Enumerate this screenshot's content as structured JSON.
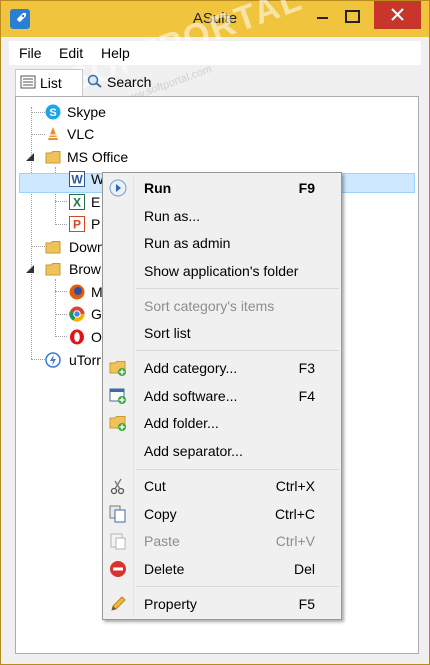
{
  "window": {
    "title": "ASuite"
  },
  "menubar": {
    "items": [
      "File",
      "Edit",
      "Help"
    ]
  },
  "tabs": [
    {
      "label": "List",
      "icon": "list-icon"
    },
    {
      "label": "Search",
      "icon": "search-icon"
    }
  ],
  "watermark": {
    "text": "SOFTPORTAL",
    "url": "www.softportal.com"
  },
  "tree": {
    "items": [
      {
        "label": "Skype",
        "icon": "skype-icon"
      },
      {
        "label": "VLC",
        "icon": "vlc-icon"
      },
      {
        "label": "MS Office",
        "icon": "folder-icon"
      },
      {
        "label": "W",
        "icon": "word-icon"
      },
      {
        "label": "E",
        "icon": "excel-icon"
      },
      {
        "label": "P",
        "icon": "powerpoint-icon"
      },
      {
        "label": "Down",
        "icon": "folder-icon"
      },
      {
        "label": "Brow",
        "icon": "folder-icon"
      },
      {
        "label": "M",
        "icon": "firefox-icon"
      },
      {
        "label": "G",
        "icon": "chrome-icon"
      },
      {
        "label": "O",
        "icon": "opera-icon"
      },
      {
        "label": "uTorr",
        "icon": "utorrent-icon"
      }
    ]
  },
  "context_menu": {
    "items": [
      {
        "label": "Run",
        "shortcut": "F9",
        "icon": "run-icon"
      },
      {
        "label": "Run as...",
        "shortcut": "",
        "icon": ""
      },
      {
        "label": "Run as admin",
        "shortcut": "",
        "icon": ""
      },
      {
        "label": "Show application's folder",
        "shortcut": "",
        "icon": ""
      },
      {
        "label": "Sort category's items",
        "shortcut": "",
        "icon": "",
        "disabled": true
      },
      {
        "label": "Sort list",
        "shortcut": "",
        "icon": ""
      },
      {
        "label": "Add category...",
        "shortcut": "F3",
        "icon": "add-category-icon"
      },
      {
        "label": "Add software...",
        "shortcut": "F4",
        "icon": "add-software-icon"
      },
      {
        "label": "Add folder...",
        "shortcut": "",
        "icon": "add-folder-icon"
      },
      {
        "label": "Add separator...",
        "shortcut": "",
        "icon": ""
      },
      {
        "label": "Cut",
        "shortcut": "Ctrl+X",
        "icon": "cut-icon"
      },
      {
        "label": "Copy",
        "shortcut": "Ctrl+C",
        "icon": "copy-icon"
      },
      {
        "label": "Paste",
        "shortcut": "Ctrl+V",
        "icon": "paste-icon",
        "disabled": true
      },
      {
        "label": "Delete",
        "shortcut": "Del",
        "icon": "delete-icon"
      },
      {
        "label": "Property",
        "shortcut": "F5",
        "icon": "property-icon"
      }
    ]
  },
  "colors": {
    "titlebar": "#f1c43e",
    "close": "#c7352b",
    "selection": "#cde8ff"
  }
}
